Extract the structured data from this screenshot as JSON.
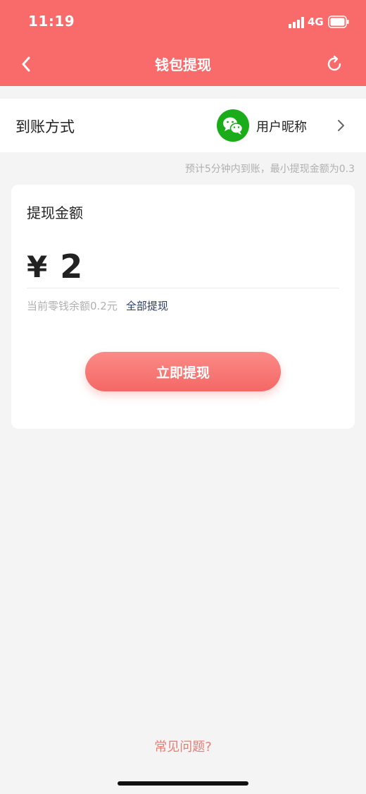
{
  "status_bar": {
    "time": "11:19",
    "network": "4G"
  },
  "nav": {
    "title": "钱包提现",
    "back_icon": "chevron-left-icon",
    "refresh_icon": "refresh-icon"
  },
  "payout_method": {
    "label": "到账方式",
    "icon": "wechat-icon",
    "nickname": "用户昵称"
  },
  "hint": "预计5分钟内到账，最小提现金额为0.3",
  "withdraw_card": {
    "title": "提现金额",
    "currency": "¥",
    "amount": "2",
    "balance_text": "当前零钱余额0.2元",
    "withdraw_all_label": "全部提现",
    "submit_label": "立即提现"
  },
  "faq_label": "常见问题?",
  "colors": {
    "brand": "#f86b6a",
    "wechat": "#1aad19",
    "link": "#2a3d6b",
    "faq": "#e87c72"
  }
}
